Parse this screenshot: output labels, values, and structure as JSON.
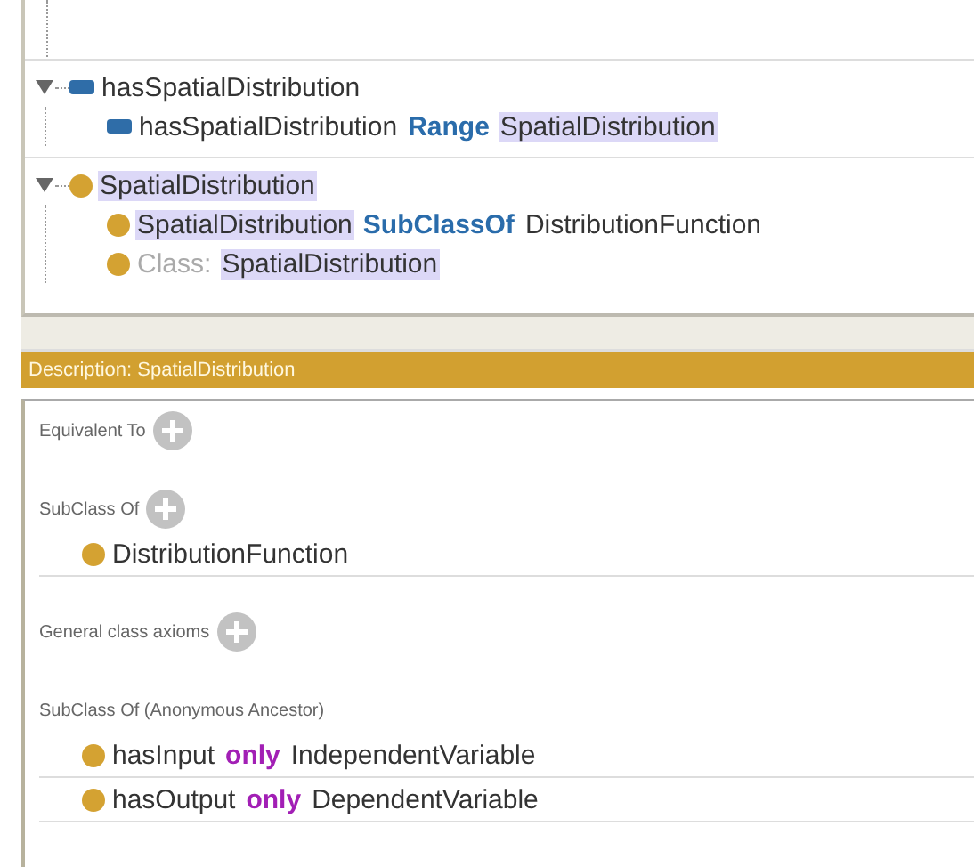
{
  "tree": [
    {
      "kind": "property",
      "expanded": true,
      "parts": [
        {
          "text": "hasSpatialDistribution",
          "kind": "name",
          "highlighted": false
        }
      ],
      "children": [
        {
          "kind": "property",
          "parts": [
            {
              "text": "hasSpatialDistribution",
              "kind": "name",
              "highlighted": false
            },
            {
              "text": "Range",
              "kind": "keyword",
              "highlighted": false
            },
            {
              "text": "SpatialDistribution",
              "kind": "name",
              "highlighted": true
            }
          ]
        }
      ]
    },
    {
      "kind": "class",
      "expanded": true,
      "parts": [
        {
          "text": "SpatialDistribution",
          "kind": "name",
          "highlighted": true
        }
      ],
      "children": [
        {
          "kind": "class",
          "parts": [
            {
              "text": "SpatialDistribution",
              "kind": "name",
              "highlighted": true
            },
            {
              "text": "SubClassOf",
              "kind": "keyword",
              "highlighted": false
            },
            {
              "text": "DistributionFunction",
              "kind": "name",
              "highlighted": false
            }
          ]
        },
        {
          "kind": "class",
          "parts": [
            {
              "text": "Class:",
              "kind": "prefix",
              "highlighted": false
            },
            {
              "text": "SpatialDistribution",
              "kind": "name",
              "highlighted": true
            }
          ]
        }
      ]
    }
  ],
  "description": {
    "title": "Description: SpatialDistribution",
    "sections": [
      {
        "label": "Equivalent To",
        "add_button": true
      },
      {
        "label": "SubClass Of",
        "add_button": true,
        "items": [
          {
            "parts": [
              {
                "text": "DistributionFunction",
                "kind": "name",
                "highlighted": false
              }
            ]
          }
        ]
      },
      {
        "label": "General class axioms",
        "add_button": true
      },
      {
        "label": "SubClass Of (Anonymous Ancestor)",
        "add_button": false,
        "items": [
          {
            "parts": [
              {
                "text": "hasInput",
                "kind": "name",
                "highlighted": false
              },
              {
                "text": "only",
                "kind": "restriction",
                "highlighted": false
              },
              {
                "text": "IndependentVariable",
                "kind": "name",
                "highlighted": false
              }
            ]
          },
          {
            "parts": [
              {
                "text": "hasOutput",
                "kind": "name",
                "highlighted": false
              },
              {
                "text": "only",
                "kind": "restriction",
                "highlighted": false
              },
              {
                "text": "DependentVariable",
                "kind": "name",
                "highlighted": false
              }
            ]
          }
        ]
      }
    ]
  }
}
